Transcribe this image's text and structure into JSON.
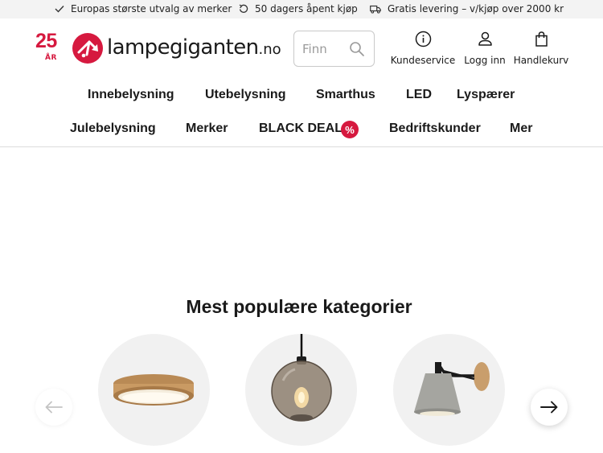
{
  "usp_bar": {
    "items": [
      {
        "icon": "check-icon",
        "text": "Europas største utvalg av merker"
      },
      {
        "icon": "return-icon",
        "text": "50 dagers åpent kjøp"
      },
      {
        "icon": "truck-icon",
        "text": "Gratis levering – v/kjøp over 2000 kr"
      }
    ]
  },
  "brand": {
    "anniversary_number": "25",
    "anniversary_unit": "ÅR",
    "name": "lampegiganten",
    "tld": ".no",
    "accent_color": "#d6193f"
  },
  "search": {
    "placeholder": "Finn",
    "value": ""
  },
  "header_actions": {
    "customer_service": "Kundeservice",
    "login": "Logg inn",
    "cart": "Handlekurv"
  },
  "nav": {
    "row1": [
      "Innebelysning",
      "Utebelysning",
      "Smarthus",
      "LED",
      "Lyspærer"
    ],
    "row2": [
      "Julebelysning",
      "Merker",
      "BLACK DEALS",
      "Bedriftskunder",
      "Mer"
    ],
    "deals_badge": "%"
  },
  "categories_section": {
    "title": "Mest populære kategorier",
    "items": [
      {
        "image": "ceiling-lamp-image"
      },
      {
        "image": "pendant-lamp-image"
      },
      {
        "image": "wall-lamp-image"
      }
    ]
  }
}
